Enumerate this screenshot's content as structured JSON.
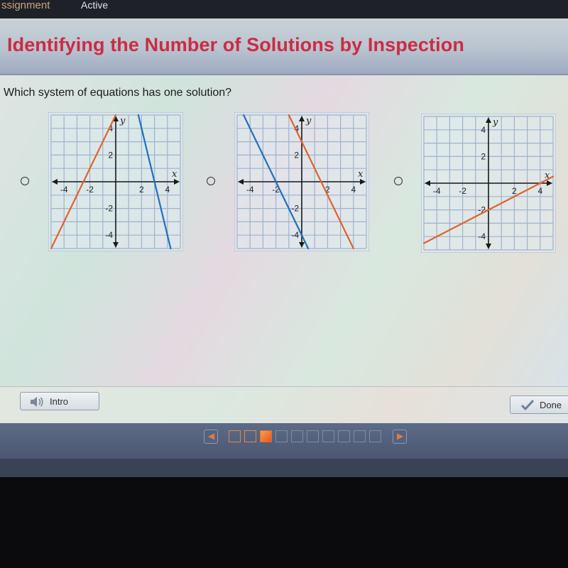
{
  "topbar": {
    "breadcrumb": "ssignment",
    "status": "Active"
  },
  "header": {
    "title": "Identifying the Number of Solutions by Inspection"
  },
  "question": {
    "text": "Which system of equations has one solution?"
  },
  "colors": {
    "title": "#cc2b44",
    "line_orange": "#e0622e",
    "line_blue": "#1f6fc4",
    "grid": "#9fb2cf",
    "axis": "#1a1a1a"
  },
  "options": [
    {
      "id": "option-a",
      "selected": false
    },
    {
      "id": "option-b",
      "selected": false
    },
    {
      "id": "option-c",
      "selected": false
    }
  ],
  "chart_data": [
    {
      "type": "line",
      "title": "",
      "xlabel": "x",
      "ylabel": "y",
      "xlim": [
        -5,
        5
      ],
      "ylim": [
        -5,
        5
      ],
      "x_ticks": [
        "-4",
        "-2",
        "2",
        "4"
      ],
      "y_ticks": [
        "4",
        "2",
        "-2",
        "-4"
      ],
      "grid": true,
      "series": [
        {
          "name": "orange-line",
          "color": "orange",
          "slope": 2,
          "intercept": 5
        },
        {
          "name": "blue-line",
          "color": "blue",
          "slope": -4,
          "intercept": 12
        }
      ]
    },
    {
      "type": "line",
      "title": "",
      "xlabel": "x",
      "ylabel": "y",
      "xlim": [
        -5,
        5
      ],
      "ylim": [
        -5,
        5
      ],
      "x_ticks": [
        "-4",
        "-2",
        "2",
        "4"
      ],
      "y_ticks": [
        "4",
        "2",
        "-2",
        "-4"
      ],
      "grid": true,
      "series": [
        {
          "name": "blue-line",
          "color": "blue",
          "slope": -2,
          "intercept": -4
        },
        {
          "name": "orange-line",
          "color": "orange",
          "slope": -2,
          "intercept": 3
        }
      ]
    },
    {
      "type": "line",
      "title": "",
      "xlabel": "x",
      "ylabel": "y",
      "xlim": [
        -5,
        5
      ],
      "ylim": [
        -5,
        5
      ],
      "x_ticks": [
        "-4",
        "-2",
        "2",
        "4"
      ],
      "y_ticks": [
        "4",
        "2",
        "-2",
        "-4"
      ],
      "grid": true,
      "series": [
        {
          "name": "orange-line",
          "color": "orange",
          "slope": 0.5,
          "intercept": -2
        }
      ]
    }
  ],
  "footer": {
    "intro_label": "Intro",
    "done_label": "Done"
  },
  "pager": {
    "prev_glyph": "◀",
    "next_glyph": "▶",
    "pages": [
      "visited",
      "visited",
      "current",
      "empty",
      "empty",
      "empty",
      "empty",
      "empty",
      "empty",
      "empty"
    ]
  }
}
